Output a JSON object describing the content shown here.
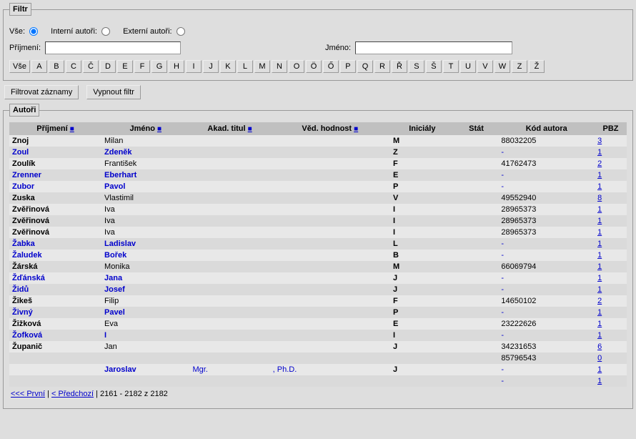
{
  "filter": {
    "legend": "Filtr",
    "all_label": "Vše:",
    "internal_label": "Interní autoři:",
    "external_label": "Externí autoři:",
    "surname_label": "Příjmení:",
    "name_label": "Jméno:",
    "alpha": [
      "Vše",
      "A",
      "B",
      "C",
      "Č",
      "D",
      "E",
      "F",
      "G",
      "H",
      "I",
      "J",
      "K",
      "L",
      "M",
      "N",
      "O",
      "Ö",
      "Ő",
      "P",
      "Q",
      "R",
      "Ř",
      "S",
      "Š",
      "T",
      "U",
      "V",
      "W",
      "Z",
      "Ž"
    ]
  },
  "actions": {
    "filter_btn": "Filtrovat záznamy",
    "clear_btn": "Vypnout filtr"
  },
  "authors": {
    "legend": "Autoři",
    "headers": {
      "prijmeni": "Příjmení",
      "jmeno": "Jméno",
      "titul": "Akad. titul",
      "hodnost": "Věd. hodnost",
      "inicialy": "Iniciály",
      "stat": "Stát",
      "kod": "Kód autora",
      "pbz": "PBZ"
    },
    "sort_glyph": "■",
    "rows": [
      {
        "prijmeni": "Znoj",
        "jmeno": "Milan",
        "titul": "",
        "hodnost": "",
        "inic": "M",
        "stat": "",
        "kod": "88032205",
        "pbz": "3",
        "link": false
      },
      {
        "prijmeni": "Zoul",
        "jmeno": "Zdeněk",
        "titul": "",
        "hodnost": "",
        "inic": "Z",
        "stat": "",
        "kod": "-",
        "pbz": "1",
        "link": true
      },
      {
        "prijmeni": "Zoulík",
        "jmeno": "František",
        "titul": "",
        "hodnost": "",
        "inic": "F",
        "stat": "",
        "kod": "41762473",
        "pbz": "2",
        "link": false
      },
      {
        "prijmeni": "Zrenner",
        "jmeno": "Eberhart",
        "titul": "",
        "hodnost": "",
        "inic": "E",
        "stat": "",
        "kod": "-",
        "pbz": "1",
        "link": true
      },
      {
        "prijmeni": "Zubor",
        "jmeno": "Pavol",
        "titul": "",
        "hodnost": "",
        "inic": "P",
        "stat": "",
        "kod": "-",
        "pbz": "1",
        "link": true
      },
      {
        "prijmeni": "Zuska",
        "jmeno": "Vlastimil",
        "titul": "",
        "hodnost": "",
        "inic": "V",
        "stat": "",
        "kod": "49552940",
        "pbz": "8",
        "link": false
      },
      {
        "prijmeni": "Zvěřinová",
        "jmeno": "Iva",
        "titul": "",
        "hodnost": "",
        "inic": "I",
        "stat": "",
        "kod": "28965373",
        "pbz": "1",
        "link": false
      },
      {
        "prijmeni": "Zvěřinová",
        "jmeno": "Iva",
        "titul": "",
        "hodnost": "",
        "inic": "I",
        "stat": "",
        "kod": "28965373",
        "pbz": "1",
        "link": false
      },
      {
        "prijmeni": "Zvěřinová",
        "jmeno": "Iva",
        "titul": "",
        "hodnost": "",
        "inic": "I",
        "stat": "",
        "kod": "28965373",
        "pbz": "1",
        "link": false
      },
      {
        "prijmeni": "Žabka",
        "jmeno": "Ladislav",
        "titul": "",
        "hodnost": "",
        "inic": "L",
        "stat": "",
        "kod": "-",
        "pbz": "1",
        "link": true
      },
      {
        "prijmeni": "Žaludek",
        "jmeno": "Bořek",
        "titul": "",
        "hodnost": "",
        "inic": "B",
        "stat": "",
        "kod": "-",
        "pbz": "1",
        "link": true
      },
      {
        "prijmeni": "Žárská",
        "jmeno": "Monika",
        "titul": "",
        "hodnost": "",
        "inic": "M",
        "stat": "",
        "kod": "66069794",
        "pbz": "1",
        "link": false
      },
      {
        "prijmeni": "Žďánská",
        "jmeno": "Jana",
        "titul": "",
        "hodnost": "",
        "inic": "J",
        "stat": "",
        "kod": "-",
        "pbz": "1",
        "link": true
      },
      {
        "prijmeni": "Židů",
        "jmeno": "Josef",
        "titul": "",
        "hodnost": "",
        "inic": "J",
        "stat": "",
        "kod": "-",
        "pbz": "1",
        "link": true
      },
      {
        "prijmeni": "Žikeš",
        "jmeno": "Filip",
        "titul": "",
        "hodnost": "",
        "inic": "F",
        "stat": "",
        "kod": "14650102",
        "pbz": "2",
        "link": false
      },
      {
        "prijmeni": "Živný",
        "jmeno": "Pavel",
        "titul": "",
        "hodnost": "",
        "inic": "P",
        "stat": "",
        "kod": "-",
        "pbz": "1",
        "link": true
      },
      {
        "prijmeni": "Žižková",
        "jmeno": "Eva",
        "titul": "",
        "hodnost": "",
        "inic": "E",
        "stat": "",
        "kod": "23222626",
        "pbz": "1",
        "link": false
      },
      {
        "prijmeni": "Žofková",
        "jmeno": "I",
        "titul": "",
        "hodnost": "",
        "inic": "I",
        "stat": "",
        "kod": "-",
        "pbz": "1",
        "link": true
      },
      {
        "prijmeni": "Županič",
        "jmeno": "Jan",
        "titul": "",
        "hodnost": "",
        "inic": "J",
        "stat": "",
        "kod": "34231653",
        "pbz": "6",
        "link": false
      },
      {
        "prijmeni": "",
        "jmeno": "",
        "titul": "",
        "hodnost": "",
        "inic": "",
        "stat": "",
        "kod": "85796543",
        "pbz": "0",
        "link": false
      },
      {
        "prijmeni": "",
        "jmeno": "Jaroslav",
        "titul": "Mgr.",
        "hodnost": ", Ph.D.",
        "inic": "J",
        "stat": "",
        "kod": "-",
        "pbz": "1",
        "link": true
      },
      {
        "prijmeni": "",
        "jmeno": "",
        "titul": "",
        "hodnost": "",
        "inic": "",
        "stat": "",
        "kod": "-",
        "pbz": "1",
        "link": true
      }
    ]
  },
  "pager": {
    "first": "<<< První",
    "prev": "< Předchozí",
    "sep": " | ",
    "info": "2161 - 2182 z 2182"
  }
}
